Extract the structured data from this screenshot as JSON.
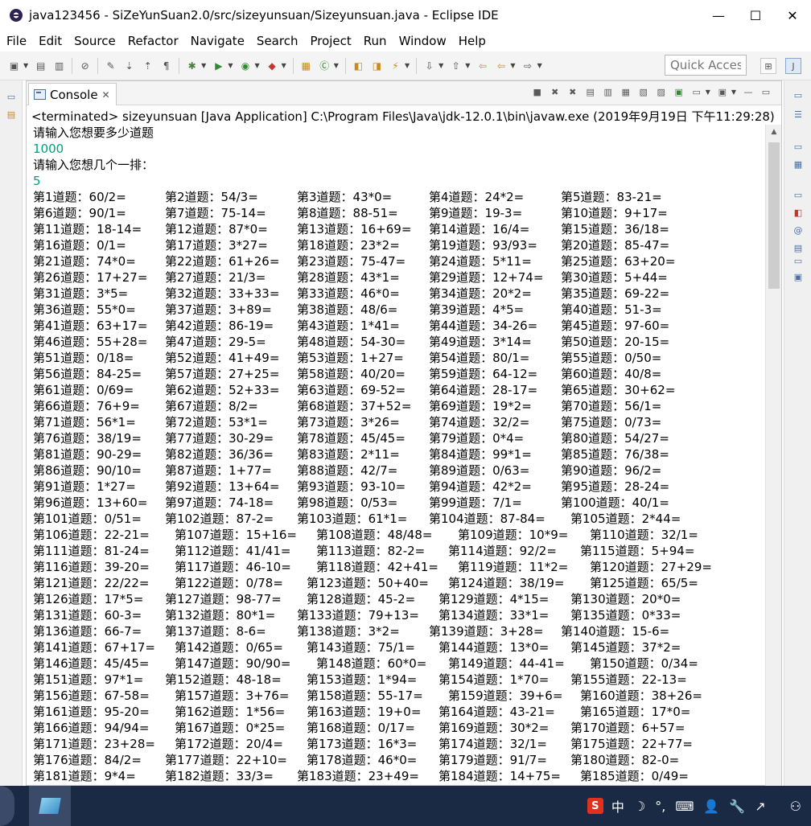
{
  "window": {
    "title": "java123456 - SiZeYunSuan2.0/src/sizeyunsuan/Sizeyunsuan.java - Eclipse IDE",
    "minimize": "—",
    "maximize": "☐",
    "close": "✕"
  },
  "menu": [
    "File",
    "Edit",
    "Source",
    "Refactor",
    "Navigate",
    "Search",
    "Project",
    "Run",
    "Window",
    "Help"
  ],
  "toolbar": {
    "quick_access_placeholder": "Quick Access"
  },
  "console": {
    "tab_label": "Console",
    "tab_close": "✕",
    "terminated": "<terminated> sizeyunsuan [Java Application] C:\\Program Files\\Java\\jdk-12.0.1\\bin\\javaw.exe (2019年9月19日 下午11:29:28)",
    "prompt_count": "请输入您想要多少道题",
    "input_count": "1000",
    "prompt_per_row": "请输入您想几个一排：",
    "input_per_row": "5",
    "questions": [
      "60/2=",
      "54/3=",
      "43*0=",
      "24*2=",
      "83-21=",
      "90/1=",
      "75-14=",
      "88-51=",
      "19-3=",
      "9+17=",
      "18-14=",
      "87*0=",
      "16+69=",
      "16/4=",
      "36/18=",
      "0/1=",
      "3*27=",
      "23*2=",
      "93/93=",
      "85-47=",
      "74*0=",
      "61+26=",
      "75-47=",
      "5*11=",
      "63+20=",
      "17+27=",
      "21/3=",
      "43*1=",
      "12+74=",
      "5+44=",
      "3*5=",
      "33+33=",
      "46*0=",
      "20*2=",
      "69-22=",
      "55*0=",
      "3+89=",
      "48/6=",
      "4*5=",
      "51-3=",
      "63+17=",
      "86-19=",
      "1*41=",
      "34-26=",
      "97-60=",
      "55+28=",
      "29-5=",
      "54-30=",
      "3*14=",
      "20-15=",
      "0/18=",
      "41+49=",
      "1+27=",
      "80/1=",
      "0/50=",
      "84-25=",
      "27+25=",
      "40/20=",
      "64-12=",
      "40/8=",
      "0/69=",
      "52+33=",
      "69-52=",
      "28-17=",
      "30+62=",
      "76+9=",
      "8/2=",
      "37+52=",
      "19*2=",
      "56/1=",
      "56*1=",
      "53*1=",
      "3*26=",
      "32/2=",
      "0/73=",
      "38/19=",
      "30-29=",
      "45/45=",
      "0*4=",
      "54/27=",
      "90-29=",
      "36/36=",
      "2*11=",
      "99*1=",
      "76/38=",
      "90/10=",
      "1+77=",
      "42/7=",
      "0/63=",
      "96/2=",
      "1*27=",
      "13+64=",
      "93-10=",
      "42*2=",
      "28-24=",
      "13+60=",
      "74-18=",
      "0/53=",
      "7/1=",
      "40/1=",
      "0/51=",
      "87-2=",
      "61*1=",
      "87-84=",
      "2*44=",
      "22-21=",
      "15+16=",
      "48/48=",
      "10*9=",
      "32/1=",
      "81-24=",
      "41/41=",
      "82-2=",
      "92/2=",
      "5+94=",
      "39-20=",
      "46-10=",
      "42+41=",
      "11*2=",
      "27+29=",
      "22/22=",
      "0/78=",
      "50+40=",
      "38/19=",
      "65/5=",
      "17*5=",
      "98-77=",
      "45-2=",
      "4*15=",
      "20*0=",
      "60-3=",
      "80*1=",
      "79+13=",
      "33*1=",
      "0*33=",
      "66-7=",
      "8-6=",
      "3*2=",
      "3+28=",
      "15-6=",
      "67+17=",
      "0/65=",
      "75/1=",
      "13*0=",
      "37*2=",
      "45/45=",
      "90/90=",
      "60*0=",
      "44-41=",
      "0/34=",
      "97*1=",
      "48-18=",
      "1*94=",
      "1*70=",
      "22-13=",
      "67-58=",
      "3+76=",
      "55-17=",
      "39+6=",
      "38+26=",
      "95-20=",
      "1*56=",
      "19+0=",
      "43-21=",
      "17*0=",
      "94/94=",
      "0*25=",
      "0/17=",
      "30*2=",
      "6+57=",
      "23+28=",
      "20/4=",
      "16*3=",
      "32/1=",
      "22+77=",
      "84/2=",
      "22+10=",
      "46*0=",
      "91/7=",
      "82-0=",
      "9*4=",
      "33/3=",
      "23+49=",
      "14+75=",
      "0/49="
    ]
  },
  "taskbar": {
    "ime_logo": "S",
    "ime_lang": "中",
    "ime_moon": "☽",
    "ime_dot": "°,",
    "ime_keyboard": "⌨",
    "ime_user": "👤",
    "ime_tool": "🔧",
    "ime_share": "↗",
    "people": "⚇"
  }
}
